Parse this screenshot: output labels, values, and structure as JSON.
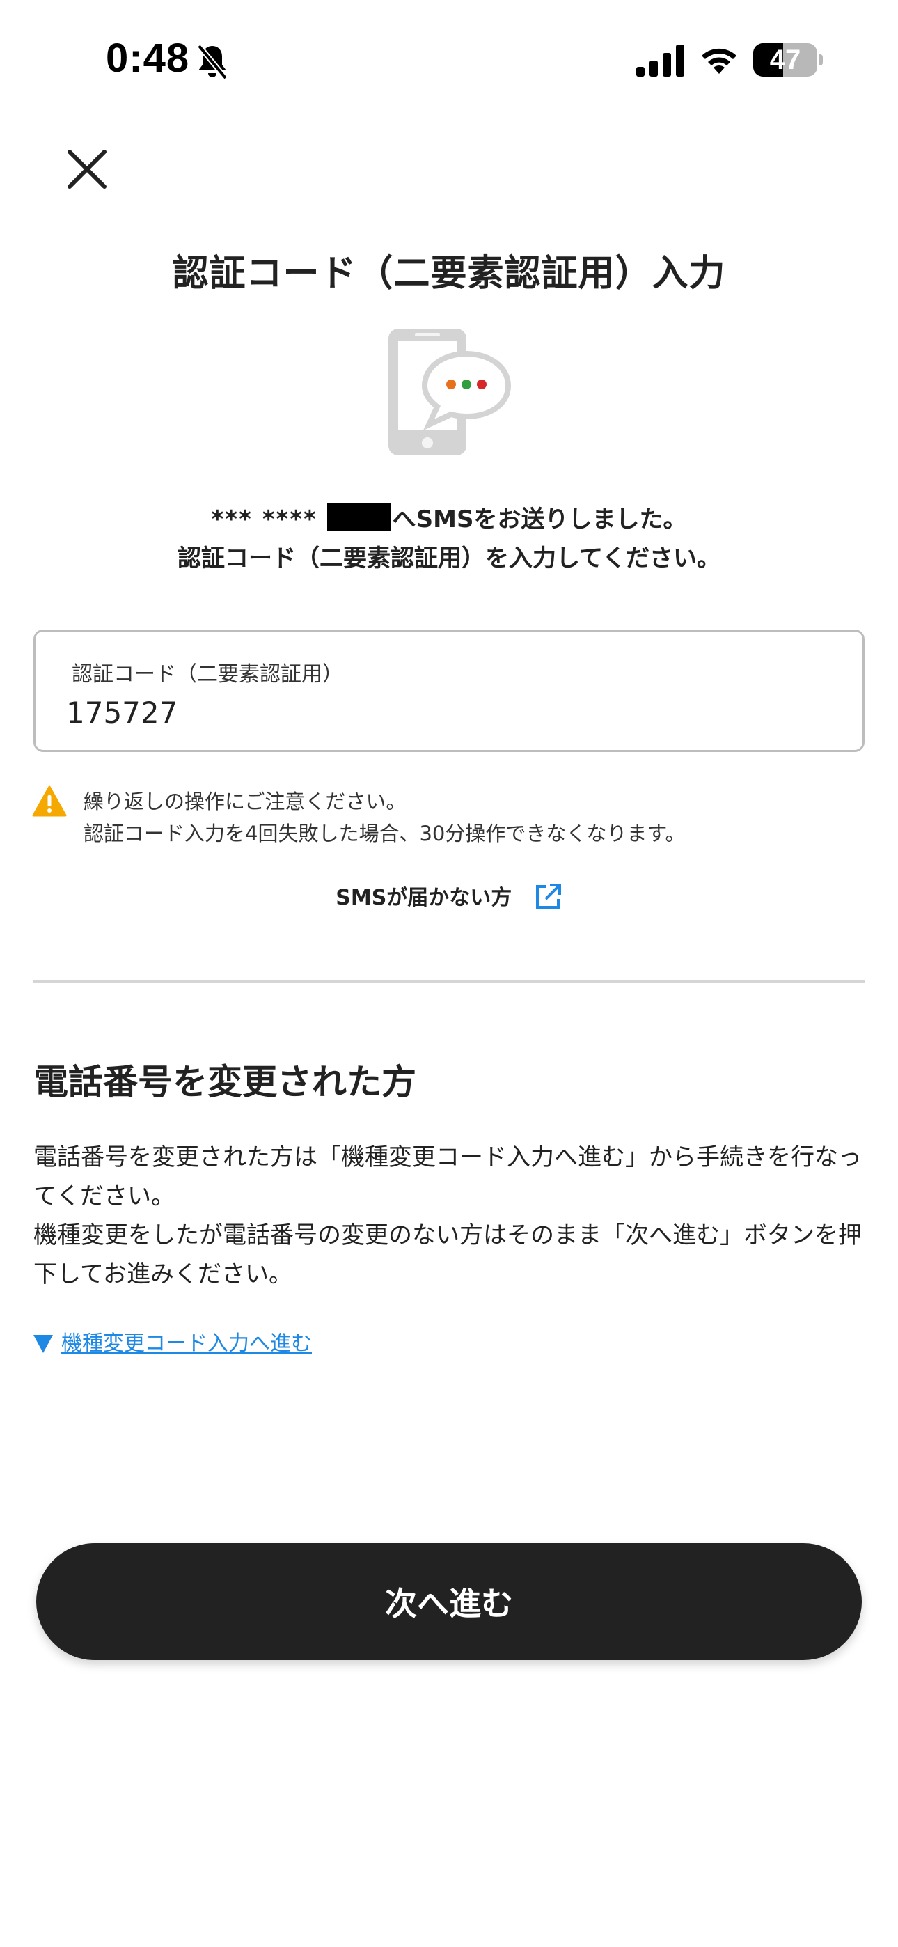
{
  "status_bar": {
    "time": "0:48",
    "battery_level": "47",
    "battery_fraction": 0.47,
    "icons": [
      "bell-off-icon",
      "signal-icon",
      "wifi-icon",
      "battery-icon"
    ]
  },
  "header": {
    "close_icon": "close-icon",
    "title": "認証コード（二要素認証用）入力"
  },
  "illustration": {
    "icon": "phone-sms-icon",
    "dot_colors": [
      "#e8701a",
      "#2e9e3e",
      "#d62828"
    ]
  },
  "message": {
    "masked_number": "*** ****",
    "line1_suffix": "へSMSをお送りしました。",
    "line2": "認証コード（二要素認証用）を入力してください。"
  },
  "code_input": {
    "label": "認証コード（二要素認証用）",
    "value": "175727"
  },
  "warning": {
    "icon": "warning-icon",
    "line1": "繰り返しの操作にご注意ください。",
    "line2": "認証コード入力を4回失敗した場合、30分操作できなくなります。"
  },
  "sms_help": {
    "label": "SMSが届かない方",
    "icon": "external-link-icon"
  },
  "phone_changed": {
    "heading": "電話番号を変更された方",
    "paragraph1": "電話番号を変更された方は「機種変更コード入力へ進む」から手続きを行なってください。",
    "paragraph2": "機種変更をしたが電話番号の変更のない方はそのまま「次へ進む」ボタンを押下してお進みください。",
    "link_label": "機種変更コード入力へ進む"
  },
  "next_button": {
    "label": "次へ進む"
  },
  "colors": {
    "accent_link": "#1e88e5",
    "button_bg": "#222222",
    "warning": "#f5a800",
    "border": "#bdbdbd"
  }
}
